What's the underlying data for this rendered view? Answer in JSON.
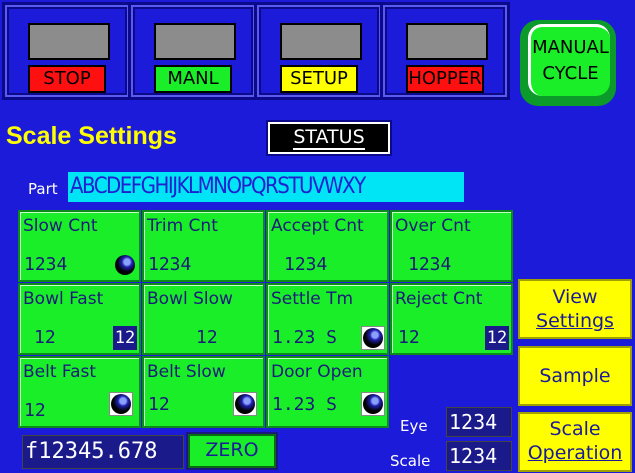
{
  "mode_buttons": [
    {
      "label": "STOP",
      "color": "#ff1010"
    },
    {
      "label": "MANL",
      "color": "#19ee28"
    },
    {
      "label": "SETUP",
      "color": "#ffff00"
    },
    {
      "label": "HOPPER",
      "color": "#ff1010"
    }
  ],
  "manual_cycle": {
    "line1": "MANUAL",
    "line2": "CYCLE"
  },
  "title": "Scale Settings",
  "status_button": "STATUS",
  "part": {
    "label": "Part",
    "value": "ABCDEFGHIJKLMNOPQRSTUVWXY"
  },
  "cells": {
    "slow_cnt": {
      "label": "Slow Cnt",
      "value": "1234"
    },
    "trim_cnt": {
      "label": "Trim Cnt",
      "value": "1234"
    },
    "accept_cnt": {
      "label": "Accept Cnt",
      "value": "1234"
    },
    "over_cnt": {
      "label": "Over Cnt",
      "value": "1234"
    },
    "bowl_fast": {
      "label": "Bowl Fast",
      "value": "12",
      "box": "12"
    },
    "bowl_slow": {
      "label": "Bowl Slow",
      "value": "12"
    },
    "settle_tm": {
      "label": "Settle Tm",
      "value": "1.23 S"
    },
    "reject_cnt": {
      "label": "Reject Cnt",
      "value": "12",
      "box": "12"
    },
    "belt_fast": {
      "label": "Belt Fast",
      "value": "12"
    },
    "belt_slow": {
      "label": "Belt Slow",
      "value": "12"
    },
    "door_open": {
      "label": "Door Open",
      "value": "1.23 S"
    }
  },
  "side_buttons": {
    "view_settings": {
      "line1": "View",
      "line2": "Settings"
    },
    "sample": "Sample",
    "scale_operation": {
      "line1": "Scale",
      "line2": "Operation"
    }
  },
  "eye": {
    "label": "Eye",
    "value": "1234"
  },
  "scale": {
    "label": "Scale",
    "value": "1234"
  },
  "weight_readout": "f12345.678",
  "zero_button": "ZERO",
  "colors": {
    "background": "#1b1bd9",
    "green": "#19ee28",
    "yellow": "#ffff00",
    "cyan": "#00e5f5"
  }
}
